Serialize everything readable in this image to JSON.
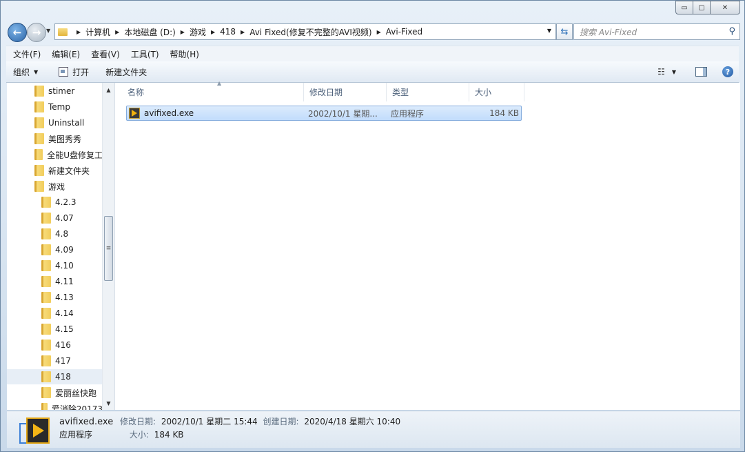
{
  "window": {
    "minimize_glyph": "▭",
    "maximize_glyph": "▢",
    "close_glyph": "✕"
  },
  "address": {
    "crumbs": [
      "计算机",
      "本地磁盘 (D:)",
      "游戏",
      "418",
      "Avi Fixed(修复不完整的AVI视频)",
      "Avi-Fixed"
    ]
  },
  "search": {
    "placeholder": "搜索 Avi-Fixed"
  },
  "menubar": {
    "items": [
      "文件(F)",
      "编辑(E)",
      "查看(V)",
      "工具(T)",
      "帮助(H)"
    ]
  },
  "toolbar": {
    "organize": "组织",
    "open": "打开",
    "new_folder": "新建文件夹"
  },
  "nav_tree": [
    {
      "label": "stimer",
      "level": 0
    },
    {
      "label": "Temp",
      "level": 0
    },
    {
      "label": "Uninstall",
      "level": 0
    },
    {
      "label": "美图秀秀",
      "level": 0
    },
    {
      "label": "全能U盘修复工",
      "level": 0
    },
    {
      "label": "新建文件夹",
      "level": 0
    },
    {
      "label": "游戏",
      "level": 0
    },
    {
      "label": "4.2.3",
      "level": 1
    },
    {
      "label": "4.07",
      "level": 1
    },
    {
      "label": "4.8",
      "level": 1
    },
    {
      "label": "4.09",
      "level": 1
    },
    {
      "label": "4.10",
      "level": 1
    },
    {
      "label": "4.11",
      "level": 1
    },
    {
      "label": "4.13",
      "level": 1
    },
    {
      "label": "4.14",
      "level": 1
    },
    {
      "label": "4.15",
      "level": 1
    },
    {
      "label": "416",
      "level": 1
    },
    {
      "label": "417",
      "level": 1
    },
    {
      "label": "418",
      "level": 1,
      "selected": true
    },
    {
      "label": "爱丽丝快跑",
      "level": 1
    },
    {
      "label": "爱消除20173",
      "level": 1
    }
  ],
  "columns": {
    "name": "名称",
    "modified": "修改日期",
    "type": "类型",
    "size": "大小"
  },
  "files": [
    {
      "name": "avifixed.exe",
      "modified": "2002/10/1 星期...",
      "type": "应用程序",
      "size": "184 KB"
    }
  ],
  "details": {
    "filename": "avifixed.exe",
    "modified_label": "修改日期:",
    "modified_value": "2002/10/1 星期二 15:44",
    "created_label": "创建日期:",
    "created_value": "2020/4/18 星期六 10:40",
    "type": "应用程序",
    "size_label": "大小:",
    "size_value": "184 KB"
  }
}
